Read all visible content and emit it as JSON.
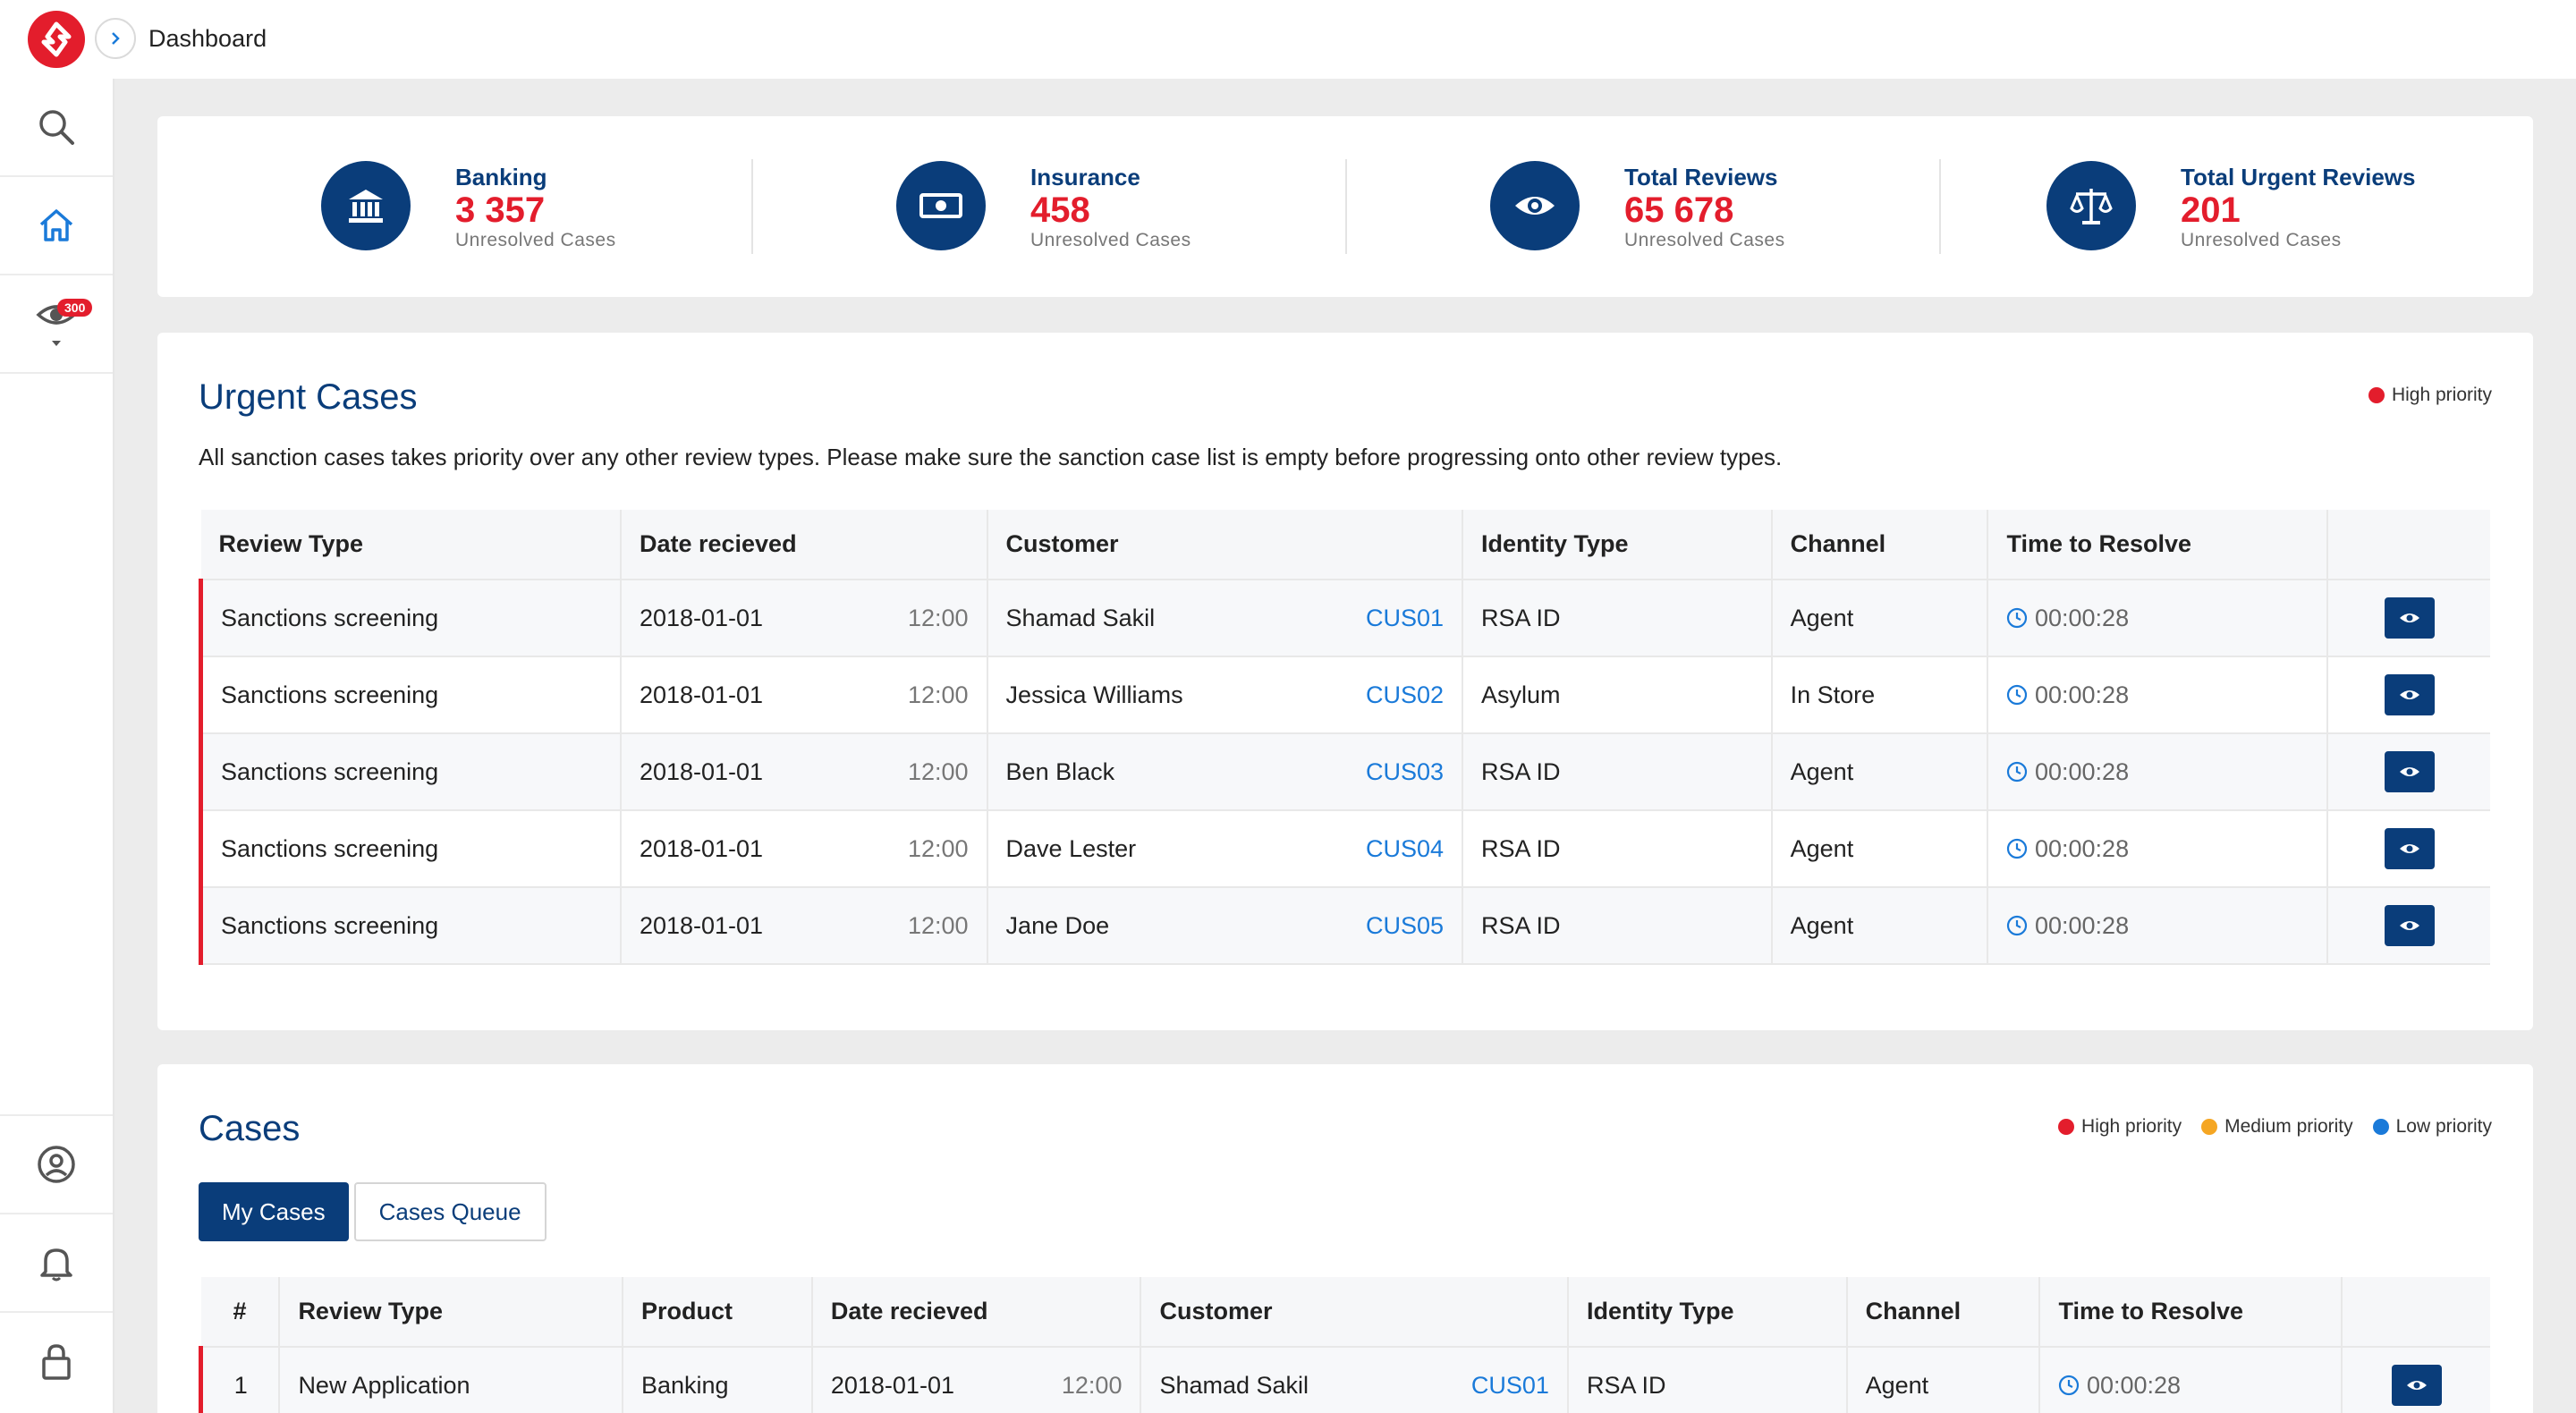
{
  "header": {
    "breadcrumb": "Dashboard"
  },
  "sidebar": {
    "reviews_badge": "300"
  },
  "stats": [
    {
      "title": "Banking",
      "value": "3 357",
      "sub": "Unresolved Cases",
      "icon": "bank-icon"
    },
    {
      "title": "Insurance",
      "value": "458",
      "sub": "Unresolved Cases",
      "icon": "money-icon"
    },
    {
      "title": "Total Reviews",
      "value": "65 678",
      "sub": "Unresolved Cases",
      "icon": "eye-icon"
    },
    {
      "title": "Total Urgent Reviews",
      "value": "201",
      "sub": "Unresolved Cases",
      "icon": "scales-icon"
    }
  ],
  "urgent": {
    "title": "Urgent Cases",
    "description": "All sanction cases takes priority over any other review types. Please make sure the sanction case list is empty before progressing onto other review types.",
    "legend": "High priority",
    "columns": [
      "Review Type",
      "Date recieved",
      "Customer",
      "Identity Type",
      "Channel",
      "Time to Resolve"
    ],
    "rows": [
      {
        "type": "Sanctions screening",
        "date": "2018-01-01",
        "time": "12:00",
        "customer": "Shamad Sakil",
        "cus": "CUS01",
        "identity": "RSA ID",
        "channel": "Agent",
        "ttr": "00:00:28"
      },
      {
        "type": "Sanctions screening",
        "date": "2018-01-01",
        "time": "12:00",
        "customer": "Jessica Williams",
        "cus": "CUS02",
        "identity": "Asylum",
        "channel": "In Store",
        "ttr": "00:00:28"
      },
      {
        "type": "Sanctions screening",
        "date": "2018-01-01",
        "time": "12:00",
        "customer": "Ben Black",
        "cus": "CUS03",
        "identity": "RSA ID",
        "channel": "Agent",
        "ttr": "00:00:28"
      },
      {
        "type": "Sanctions screening",
        "date": "2018-01-01",
        "time": "12:00",
        "customer": "Dave Lester",
        "cus": "CUS04",
        "identity": "RSA ID",
        "channel": "Agent",
        "ttr": "00:00:28"
      },
      {
        "type": "Sanctions screening",
        "date": "2018-01-01",
        "time": "12:00",
        "customer": "Jane Doe",
        "cus": "CUS05",
        "identity": "RSA ID",
        "channel": "Agent",
        "ttr": "00:00:28"
      }
    ]
  },
  "cases": {
    "title": "Cases",
    "legend": {
      "high": "High priority",
      "medium": "Medium priority",
      "low": "Low priority"
    },
    "tabs": {
      "my": "My Cases",
      "queue": "Cases Queue"
    },
    "columns": [
      "#",
      "Review Type",
      "Product",
      "Date recieved",
      "Customer",
      "Identity Type",
      "Channel",
      "Time to Resolve"
    ],
    "rows": [
      {
        "num": "1",
        "type": "New Application",
        "product": "Banking",
        "date": "2018-01-01",
        "time": "12:00",
        "customer": "Shamad Sakil",
        "cus": "CUS01",
        "identity": "RSA ID",
        "channel": "Agent",
        "ttr": "00:00:28"
      }
    ]
  },
  "colors": {
    "primary": "#0a3d7a",
    "high": "#e31d2c",
    "medium": "#f5a623",
    "low": "#1a7ad9"
  }
}
